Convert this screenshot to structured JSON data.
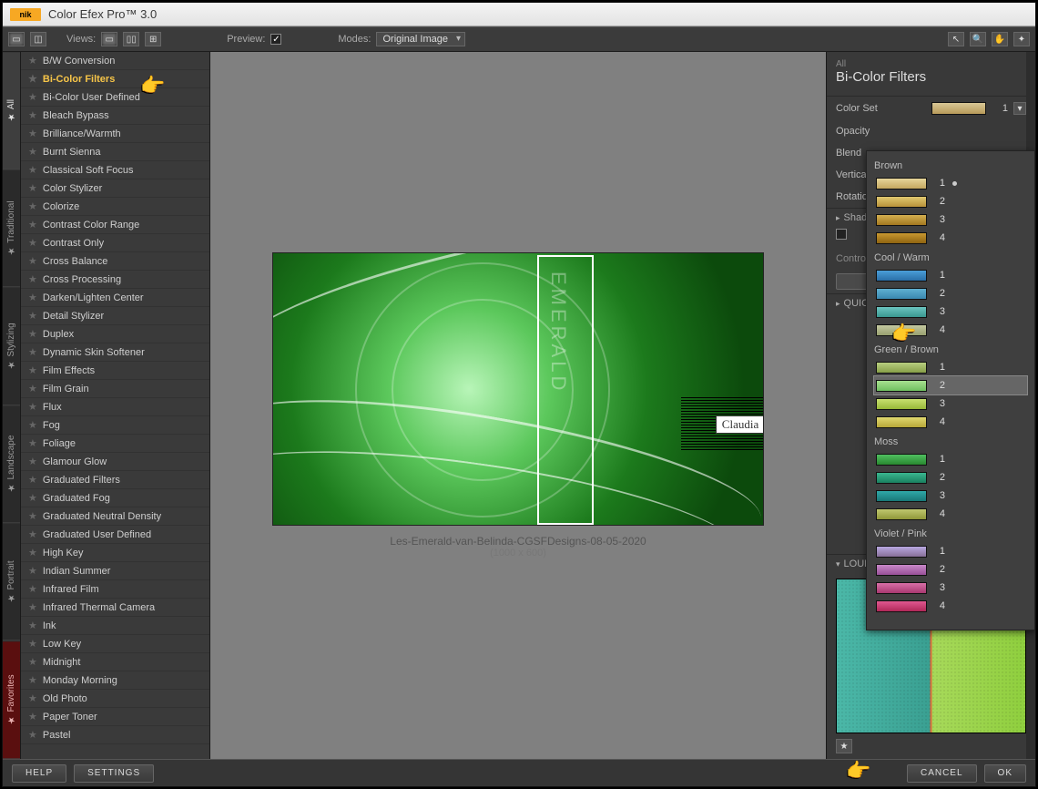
{
  "title": "Color Efex Pro™ 3.0",
  "logo": "nik",
  "toolbar": {
    "views_label": "Views:",
    "preview_label": "Preview:",
    "modes_label": "Modes:",
    "modes_value": "Original Image"
  },
  "left_tabs": [
    "All",
    "Traditional",
    "Stylizing",
    "Landscape",
    "Portrait",
    "Favorites"
  ],
  "active_tab": "All",
  "selected_filter_index": 1,
  "filters": [
    "B/W Conversion",
    "Bi-Color Filters",
    "Bi-Color User Defined",
    "Bleach Bypass",
    "Brilliance/Warmth",
    "Burnt Sienna",
    "Classical Soft Focus",
    "Color Stylizer",
    "Colorize",
    "Contrast Color Range",
    "Contrast Only",
    "Cross Balance",
    "Cross Processing",
    "Darken/Lighten Center",
    "Detail Stylizer",
    "Duplex",
    "Dynamic Skin Softener",
    "Film Effects",
    "Film Grain",
    "Flux",
    "Fog",
    "Foliage",
    "Glamour Glow",
    "Graduated Filters",
    "Graduated Fog",
    "Graduated Neutral Density",
    "Graduated User Defined",
    "High Key",
    "Indian Summer",
    "Infrared Film",
    "Infrared Thermal Camera",
    "Ink",
    "Low Key",
    "Midnight",
    "Monday Morning",
    "Old Photo",
    "Paper Toner",
    "Pastel"
  ],
  "preview": {
    "caption": "Les-Emerald-van-Belinda-CGSFDesigns-08-05-2020",
    "dim": "(1000 x 600)",
    "overlay_text": "EMERALD",
    "watermark": "Claudia"
  },
  "right": {
    "crumb": "All",
    "title": "Bi-Color Filters",
    "params": {
      "color_set": "Color Set",
      "color_set_val": "1",
      "opacity": "Opacity",
      "blend": "Blend",
      "vshift": "Vertical Shift",
      "rotation": "Rotation"
    },
    "shadows": "Shadows / Highlights",
    "control_points": "Control Points",
    "quick_save": "QUICK SAVE",
    "loupe": "LOUPE"
  },
  "popup": {
    "groups": [
      {
        "name": "Brown",
        "cls": "br",
        "sel": -1,
        "dot": 0
      },
      {
        "name": "Cool / Warm",
        "cls": "cw",
        "sel": -1,
        "dot": -1
      },
      {
        "name": "Green / Brown",
        "cls": "gb",
        "sel": 1,
        "dot": -1
      },
      {
        "name": "Moss",
        "cls": "mo",
        "sel": -1,
        "dot": -1
      },
      {
        "name": "Violet / Pink",
        "cls": "vp",
        "sel": -1,
        "dot": -1
      }
    ]
  },
  "footer": {
    "help": "HELP",
    "settings": "SETTINGS",
    "cancel": "CANCEL",
    "ok": "OK"
  }
}
